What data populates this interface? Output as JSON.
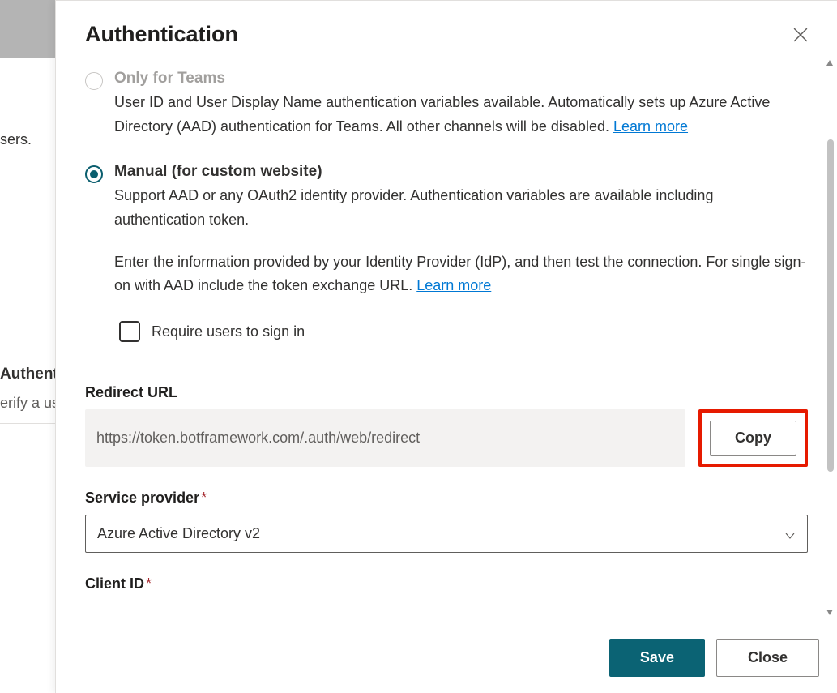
{
  "backdrop": {
    "line1": "sers.",
    "section_title": "Authent",
    "section_sub": "erify a us"
  },
  "dialog": {
    "title": "Authentication"
  },
  "options": {
    "teams": {
      "title": "Only for Teams",
      "desc_a": "User ID and User Display Name authentication variables available. Automatically sets up Azure Active Directory (AAD) authentication for Teams. All other channels will be disabled. ",
      "learn_more": "Learn more"
    },
    "manual": {
      "title": "Manual (for custom website)",
      "desc_a": "Support AAD or any OAuth2 identity provider. Authentication variables are available including authentication token.",
      "desc_b": "Enter the information provided by your Identity Provider (IdP), and then test the connection. For single sign-on with AAD include the token exchange URL. ",
      "learn_more": "Learn more",
      "require_signin": "Require users to sign in"
    }
  },
  "fields": {
    "redirect": {
      "label": "Redirect URL",
      "value": "https://token.botframework.com/.auth/web/redirect",
      "copy": "Copy"
    },
    "provider": {
      "label": "Service provider",
      "value": "Azure Active Directory v2"
    },
    "client_id": {
      "label": "Client ID"
    }
  },
  "footer": {
    "save": "Save",
    "close": "Close"
  }
}
